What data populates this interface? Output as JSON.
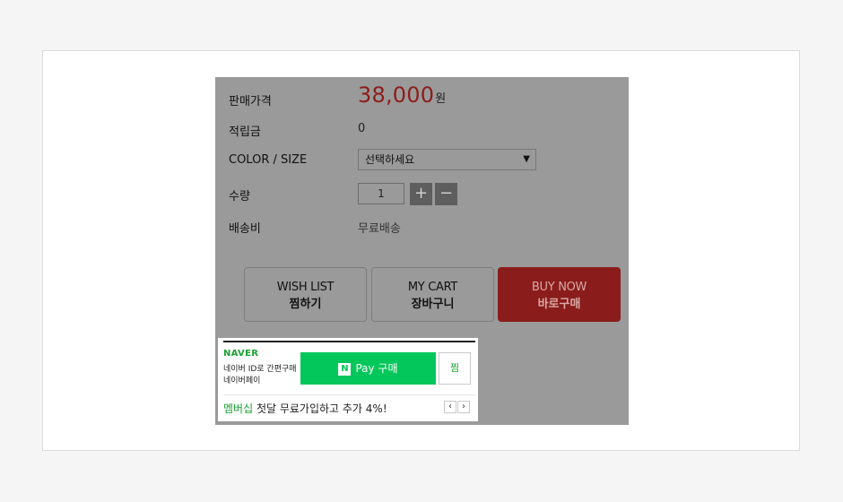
{
  "product": {
    "price_label": "판매가격",
    "price_value": "38,000",
    "price_unit": "원",
    "points_label": "적립금",
    "points_value": "0",
    "option_label": "COLOR / SIZE",
    "option_selected": "선택하세요",
    "qty_label": "수량",
    "qty_value": "1",
    "shipping_label": "배송비",
    "shipping_value": "무료배송"
  },
  "buttons": {
    "wishlist_en": "WISH LIST",
    "wishlist_ko": "찜하기",
    "cart_en": "MY CART",
    "cart_ko": "장바구니",
    "buy_en": "BUY NOW",
    "buy_ko": "바로구매"
  },
  "naver_pay": {
    "brand": "NAVER",
    "sub1": "네이버 ID로 간편구매",
    "sub2": "네이버페이",
    "pay_label": "Pay 구매",
    "zzim_label": "찜",
    "promo_highlight": "멤버십",
    "promo_text": " 첫달 무료가입하고 추가 4%!"
  },
  "colors": {
    "overlay_gray": "#9a9a9a",
    "price_red": "#8e1d1b",
    "buy_bg": "#8a1d1b",
    "naver_green": "#03c75a"
  }
}
